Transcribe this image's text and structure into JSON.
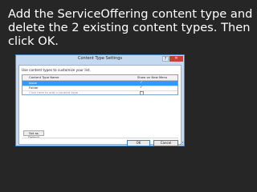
{
  "slide": {
    "instruction": "Add the ServiceOffering content type and delete the 2 existing content types.  Then click OK."
  },
  "dialog": {
    "title": "Content Type Settings",
    "help_label": "?",
    "close_label": "✕",
    "instructions": "Use content types to customize your list.",
    "columns": [
      "Content Type Name",
      "Show on New Menu"
    ],
    "rows": [
      {
        "name": "Issue",
        "show_on_new_menu": true,
        "selected": true
      },
      {
        "name": "Folder",
        "show_on_new_menu": true,
        "selected": false
      },
      {
        "name": "Click here to add a content type",
        "show_on_new_menu": false,
        "selected": false,
        "placeholder": true
      }
    ],
    "set_default_label": "Set as Default",
    "ok_label": "OK",
    "cancel_label": "Cancel",
    "colors": {
      "frame": "#c5daf1",
      "selection": "#3399ff",
      "close": "#c7413a"
    }
  }
}
